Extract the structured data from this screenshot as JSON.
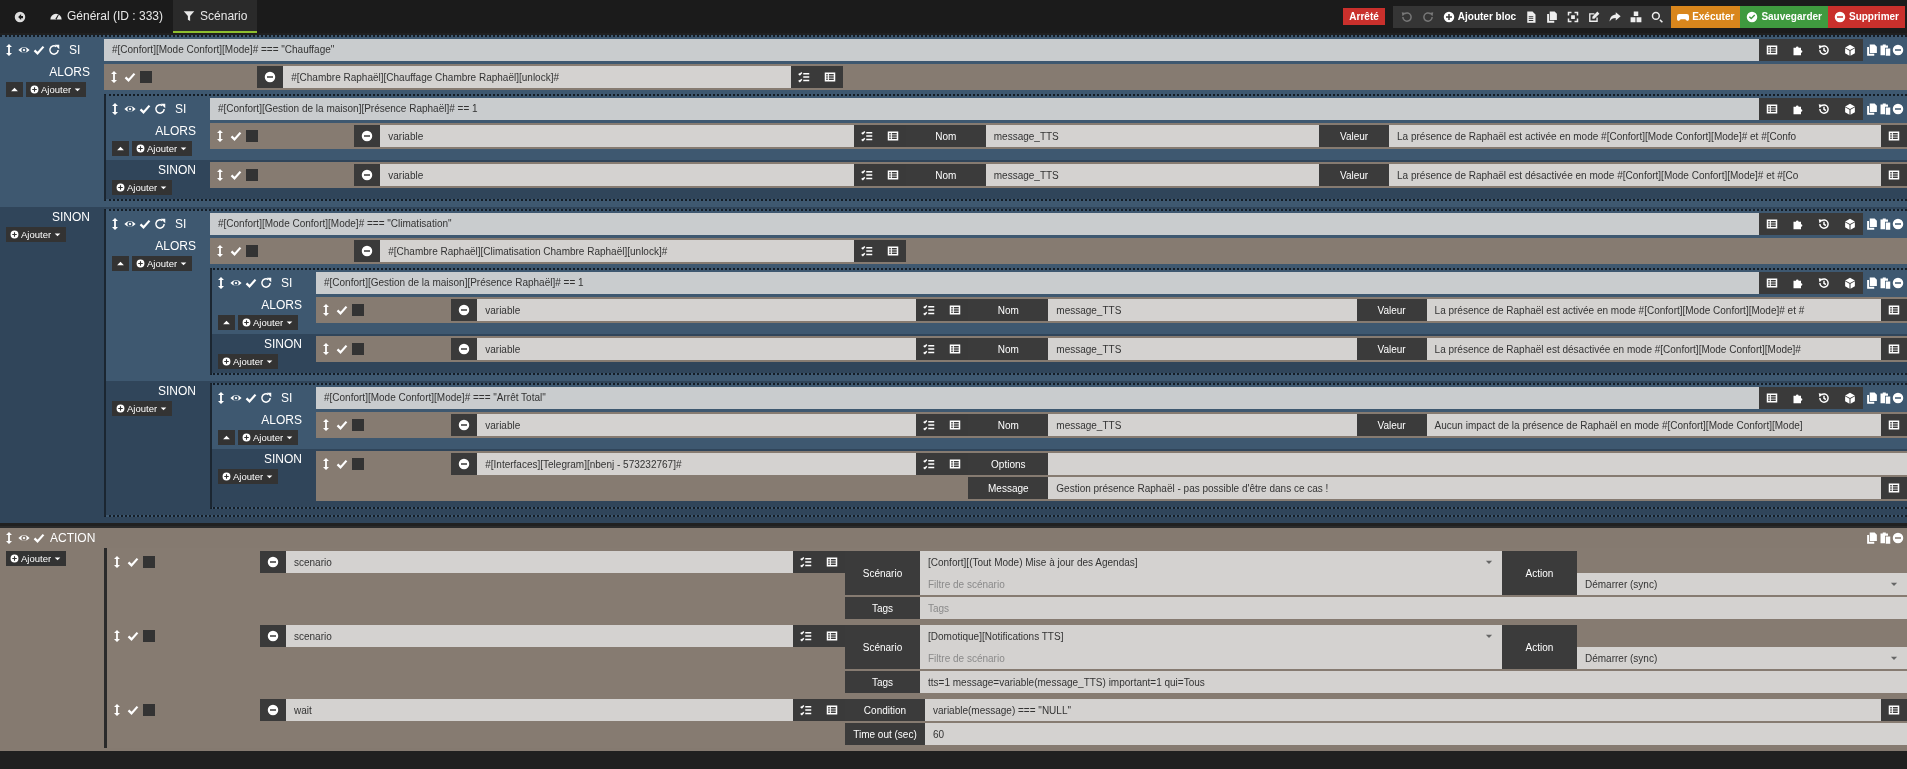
{
  "tabs": [
    {
      "label": "Général (ID : 333)",
      "selected": false
    },
    {
      "label": "Scénario",
      "selected": true
    }
  ],
  "status": "Arrêté",
  "add_block": "Ajouter bloc",
  "actions": [
    {
      "kind": "run",
      "label": "Exécuter"
    },
    {
      "kind": "save",
      "label": "Sauvegarder"
    },
    {
      "kind": "delete",
      "label": "Supprimer"
    }
  ],
  "blocks": [
    {
      "kind": "if",
      "enabled": true,
      "if_label": "SI",
      "condition": "#[Confort][Mode Confort][Mode]# === \"Chauffage\"",
      "then_label": "ALORS",
      "then_add": "Ajouter",
      "then": [
        {
          "kind": "action",
          "enabled": true,
          "parallel": false,
          "command": "#[Chambre Raphaël][Chauffage Chambre Raphaël][unlock]#"
        },
        {
          "kind": "if",
          "enabled": true,
          "if_label": "SI",
          "condition": "#[Confort][Gestion de la maison][Présence Raphaël]# == 1",
          "then_label": "ALORS",
          "then_add": "Ajouter",
          "then": [
            {
              "kind": "action",
              "enabled": true,
              "parallel": false,
              "command": "variable",
              "options": {
                "kind": "variable",
                "name_label": "Nom",
                "name": "message_TTS",
                "value_label": "Valeur",
                "value": "La présence de Raphaël est activée en mode #[Confort][Mode Confort][Mode]# et #[Confo"
              }
            }
          ],
          "else_label": "SINON",
          "else_add": "Ajouter",
          "else": [
            {
              "kind": "action",
              "enabled": true,
              "parallel": false,
              "command": "variable",
              "options": {
                "kind": "variable",
                "name_label": "Nom",
                "name": "message_TTS",
                "value_label": "Valeur",
                "value": "La présence de Raphaël est désactivée en mode #[Confort][Mode Confort][Mode]# et #[Co"
              }
            }
          ]
        }
      ],
      "else_label": "SINON",
      "else_add": "Ajouter",
      "else": [
        {
          "kind": "if",
          "enabled": true,
          "if_label": "SI",
          "condition": "#[Confort][Mode Confort][Mode]# === \"Climatisation\"",
          "then_label": "ALORS",
          "then_add": "Ajouter",
          "then": [
            {
              "kind": "action",
              "enabled": true,
              "parallel": false,
              "command": "#[Chambre Raphaël][Climatisation Chambre Raphaël][unlock]#"
            },
            {
              "kind": "if",
              "enabled": true,
              "if_label": "SI",
              "condition": "#[Confort][Gestion de la maison][Présence Raphaël]# == 1",
              "then_label": "ALORS",
              "then_add": "Ajouter",
              "then": [
                {
                  "kind": "action",
                  "enabled": true,
                  "parallel": false,
                  "command": "variable",
                  "options": {
                    "kind": "variable",
                    "name_label": "Nom",
                    "name": "message_TTS",
                    "value_label": "Valeur",
                    "value": "La présence de Raphaël est activée en mode #[Confort][Mode Confort][Mode]# et #"
                  }
                }
              ],
              "else_label": "SINON",
              "else_add": "Ajouter",
              "else": [
                {
                  "kind": "action",
                  "enabled": true,
                  "parallel": false,
                  "command": "variable",
                  "options": {
                    "kind": "variable",
                    "name_label": "Nom",
                    "name": "message_TTS",
                    "value_label": "Valeur",
                    "value": "La présence de Raphaël est désactivée en mode #[Confort][Mode Confort][Mode]#"
                  }
                }
              ]
            }
          ],
          "else_label": "SINON",
          "else_add": "Ajouter",
          "else": [
            {
              "kind": "if",
              "enabled": true,
              "if_label": "SI",
              "condition": "#[Confort][Mode Confort][Mode]# === \"Arrêt Total\"",
              "then_label": "ALORS",
              "then_add": "Ajouter",
              "then": [
                {
                  "kind": "action",
                  "enabled": true,
                  "parallel": false,
                  "command": "variable",
                  "options": {
                    "kind": "variable",
                    "name_label": "Nom",
                    "name": "message_TTS",
                    "value_label": "Valeur",
                    "value": "Aucun impact de la présence de Raphaël en mode #[Confort][Mode Confort][Mode]"
                  }
                }
              ],
              "else_label": "SINON",
              "else_add": "Ajouter",
              "else": [
                {
                  "kind": "action",
                  "enabled": true,
                  "parallel": false,
                  "command": "#[Interfaces][Telegram][nbenj - 573232767]#",
                  "options": {
                    "kind": "message",
                    "options_label": "Options",
                    "message_label": "Message",
                    "message": "Gestion présence Raphaël - pas possible d'être dans ce cas !"
                  }
                }
              ]
            }
          ]
        }
      ]
    },
    {
      "kind": "action_block",
      "enabled": true,
      "label": "ACTION",
      "add": "Ajouter",
      "actions": [
        {
          "kind": "action",
          "enabled": true,
          "parallel": false,
          "command": "scenario",
          "options": {
            "kind": "scenario",
            "scenario_label": "Scénario",
            "scenario": "[Confort][(Tout Mode) Mise à jour des Agendas]",
            "filter_placeholder": "Filtre de scénario",
            "action_label": "Action",
            "action": "Démarrer (sync)",
            "tags_label": "Tags",
            "tags_placeholder": "Tags"
          }
        },
        {
          "kind": "action",
          "enabled": true,
          "parallel": false,
          "command": "scenario",
          "options": {
            "kind": "scenario",
            "scenario_label": "Scénario",
            "scenario": "[Domotique][Notifications TTS]",
            "filter_placeholder": "Filtre de scénario",
            "action_label": "Action",
            "action": "Démarrer (sync)",
            "tags_label": "Tags",
            "tags": "tts=1 message=variable(message_TTS) important=1 qui=Tous"
          }
        },
        {
          "kind": "action",
          "enabled": true,
          "parallel": false,
          "command": "wait",
          "options": {
            "kind": "wait",
            "condition_label": "Condition",
            "condition": "variable(message) === \"NULL\"",
            "timeout_label": "Time out (sec)",
            "timeout": "60"
          }
        }
      ]
    }
  ]
}
